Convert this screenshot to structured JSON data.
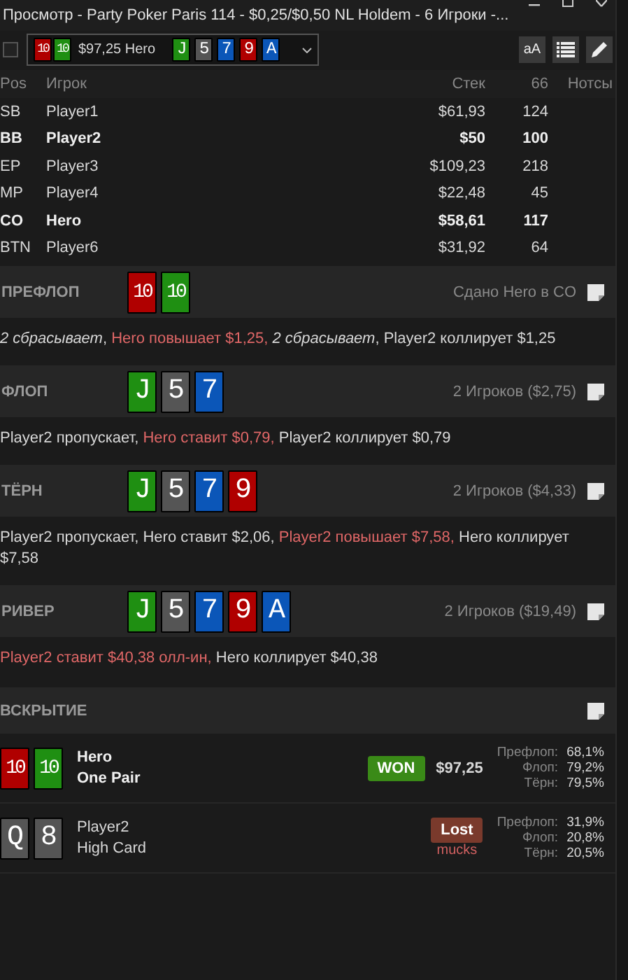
{
  "window": {
    "title": "Просмотр - Party Poker Paris 114 - $0,25/$0,50 NL Holdem - 6 Игроки -..."
  },
  "toolbar": {
    "checked": false,
    "hand": {
      "hole": [
        {
          "rank": "10",
          "color": "#b00000"
        },
        {
          "rank": "10",
          "color": "#1f8f12"
        }
      ],
      "label": "$97,25 Hero",
      "board": [
        {
          "rank": "J",
          "color": "#1f8f12"
        },
        {
          "rank": "5",
          "color": "#555555"
        },
        {
          "rank": "7",
          "color": "#0b56b8"
        },
        {
          "rank": "9",
          "color": "#b00000"
        },
        {
          "rank": "A",
          "color": "#0b56b8"
        }
      ]
    },
    "font_button": "aA"
  },
  "players": {
    "columns": [
      "Pos",
      "Игрок",
      "Стек",
      "66",
      "Нотсы"
    ],
    "rows": [
      {
        "pos": "SB",
        "name": "Player1",
        "stack": "$61,93",
        "bb": "124",
        "bold": false
      },
      {
        "pos": "BB",
        "name": "Player2",
        "stack": "$50",
        "bb": "100",
        "bold": true
      },
      {
        "pos": "EP",
        "name": "Player3",
        "stack": "$109,23",
        "bb": "218",
        "bold": false
      },
      {
        "pos": "MP",
        "name": "Player4",
        "stack": "$22,48",
        "bb": "45",
        "bold": false
      },
      {
        "pos": "CO",
        "name": "Hero",
        "stack": "$58,61",
        "bb": "117",
        "bold": true
      },
      {
        "pos": "BTN",
        "name": "Player6",
        "stack": "$31,92",
        "bb": "64",
        "bold": false
      }
    ]
  },
  "streets": [
    {
      "name": "ПРЕФЛОП",
      "cards": [
        {
          "rank": "10",
          "color": "#b00000"
        },
        {
          "rank": "10",
          "color": "#1f8f12"
        }
      ],
      "info": "Сдано Hero в CO",
      "actions": [
        {
          "kind": "fold",
          "text": "2 сбрасывает"
        },
        {
          "kind": "plain",
          "text": ", "
        },
        {
          "kind": "hero",
          "text": "Hero повышает $1,25, "
        },
        {
          "kind": "fold",
          "text": "2 сбрасывает"
        },
        {
          "kind": "plain",
          "text": ", Player2 коллирует $1,25"
        }
      ]
    },
    {
      "name": "ФЛОП",
      "cards": [
        {
          "rank": "J",
          "color": "#1f8f12"
        },
        {
          "rank": "5",
          "color": "#555555"
        },
        {
          "rank": "7",
          "color": "#0b56b8"
        }
      ],
      "info": "2 Игроков ($2,75)",
      "actions": [
        {
          "kind": "plain",
          "text": "Player2 пропускает, "
        },
        {
          "kind": "hero",
          "text": "Hero ставит $0,79, "
        },
        {
          "kind": "plain",
          "text": "Player2 коллирует $0,79"
        }
      ]
    },
    {
      "name": "ТЁРН",
      "cards": [
        {
          "rank": "J",
          "color": "#1f8f12"
        },
        {
          "rank": "5",
          "color": "#555555"
        },
        {
          "rank": "7",
          "color": "#0b56b8"
        },
        {
          "rank": "9",
          "color": "#b00000"
        }
      ],
      "info": "2 Игроков ($4,33)",
      "actions": [
        {
          "kind": "plain",
          "text": "Player2 пропускает, Hero ставит $2,06, "
        },
        {
          "kind": "hero",
          "text": "Player2 повышает $7,58, "
        },
        {
          "kind": "plain",
          "text": "Hero коллирует $7,58"
        }
      ]
    },
    {
      "name": "РИВЕР",
      "cards": [
        {
          "rank": "J",
          "color": "#1f8f12"
        },
        {
          "rank": "5",
          "color": "#555555"
        },
        {
          "rank": "7",
          "color": "#0b56b8"
        },
        {
          "rank": "9",
          "color": "#b00000"
        },
        {
          "rank": "A",
          "color": "#0b56b8"
        }
      ],
      "info": "2 Игроков ($19,49)",
      "actions": [
        {
          "kind": "hero",
          "text": "Player2 ставит $40,38 олл-ин, "
        },
        {
          "kind": "plain",
          "text": "Hero коллирует $40,38"
        }
      ]
    }
  ],
  "showdown": {
    "title": "ВСКРЫТИЕ",
    "players": [
      {
        "cards": [
          {
            "rank": "10",
            "color": "#b00000"
          },
          {
            "rank": "10",
            "color": "#1f8f12"
          }
        ],
        "name": "Hero",
        "hand": "One Pair",
        "bold": true,
        "result": {
          "kind": "won",
          "label": "WON"
        },
        "amount": "$97,25",
        "equity": [
          {
            "label": "Префлоп:",
            "value": "68,1%"
          },
          {
            "label": "Флоп:",
            "value": "79,2%"
          },
          {
            "label": "Тёрн:",
            "value": "79,5%"
          }
        ]
      },
      {
        "cards": [
          {
            "rank": "Q",
            "color": "#555555"
          },
          {
            "rank": "8",
            "color": "#555555"
          }
        ],
        "name": "Player2",
        "hand": "High Card",
        "bold": false,
        "result": {
          "kind": "lost",
          "label": "Lost"
        },
        "note": "mucks",
        "equity": [
          {
            "label": "Префлоп:",
            "value": "31,9%"
          },
          {
            "label": "Флоп:",
            "value": "20,8%"
          },
          {
            "label": "Тёрн:",
            "value": "20,5%"
          }
        ]
      }
    ]
  }
}
